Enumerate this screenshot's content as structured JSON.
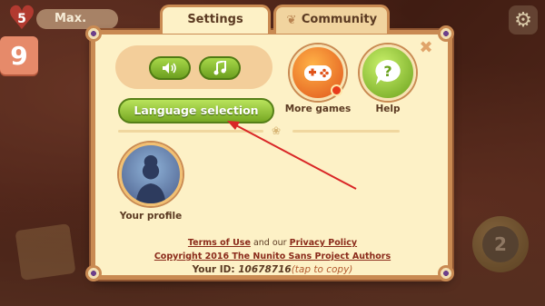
{
  "hud": {
    "lives": "5",
    "lives_status": "Max.",
    "level": "9"
  },
  "background": {
    "counter": "2"
  },
  "tabs": {
    "settings": "Settings",
    "community": "Community"
  },
  "settings": {
    "sound_icon": "speaker-icon",
    "music_icon": "music-note-icon",
    "language_button": "Language selection",
    "more_games_label": "More games",
    "help_label": "Help",
    "profile_label": "Your profile"
  },
  "footer": {
    "terms": "Terms of Use",
    "and_our": "and our",
    "privacy": "Privacy Policy",
    "copyright": "Copyright 2016 The Nunito Sans Project Authors",
    "user_id_prefix": "Your ID:",
    "user_id": "10678716",
    "tap_to_copy": "(tap to copy)"
  },
  "colors": {
    "dialog_bg": "#fdf1c6",
    "frame": "#c98a52",
    "green_button": "#77a823",
    "orange_button": "#e0541b",
    "annotation_arrow": "#d92626"
  }
}
